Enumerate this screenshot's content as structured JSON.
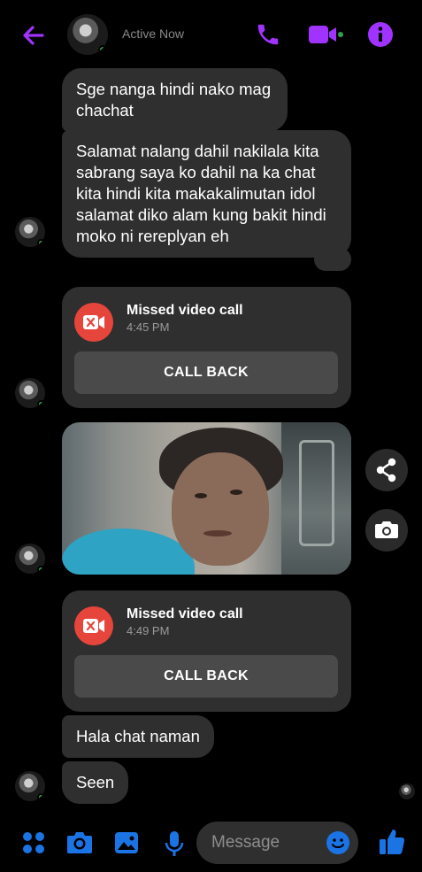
{
  "header": {
    "status_text": "Active Now"
  },
  "messages": [
    {
      "text": "Sge nanga hindi nako mag chachat"
    },
    {
      "text": "Salamat nalang dahil nakilala kita sabrang saya ko dahil na ka chat kita hindi kita makakalimutan idol salamat diko alam kung bakit hindi moko ni rereplyan eh"
    }
  ],
  "missed_calls": [
    {
      "title": "Missed video call",
      "time": "4:45 PM",
      "action": "CALL BACK"
    },
    {
      "title": "Missed video call",
      "time": "4:49 PM",
      "action": "CALL BACK"
    }
  ],
  "messages_after": [
    {
      "text": "Hala chat naman"
    },
    {
      "text": "Seen"
    }
  ],
  "composer": {
    "placeholder": "Message"
  },
  "icons": {
    "back": "back-arrow-icon",
    "call": "phone-icon",
    "video": "video-camera-icon",
    "info": "info-icon",
    "share": "share-icon",
    "camera": "camera-icon",
    "apps": "apps-grid-icon",
    "gallery": "gallery-icon",
    "mic": "microphone-icon",
    "emoji": "emoji-icon",
    "like": "thumbs-up-icon"
  },
  "colors": {
    "accent": "#a033ff",
    "blue": "#1b74e4",
    "bubble": "#2f2f2f",
    "missed": "#e5453b",
    "online": "#31a24c"
  }
}
